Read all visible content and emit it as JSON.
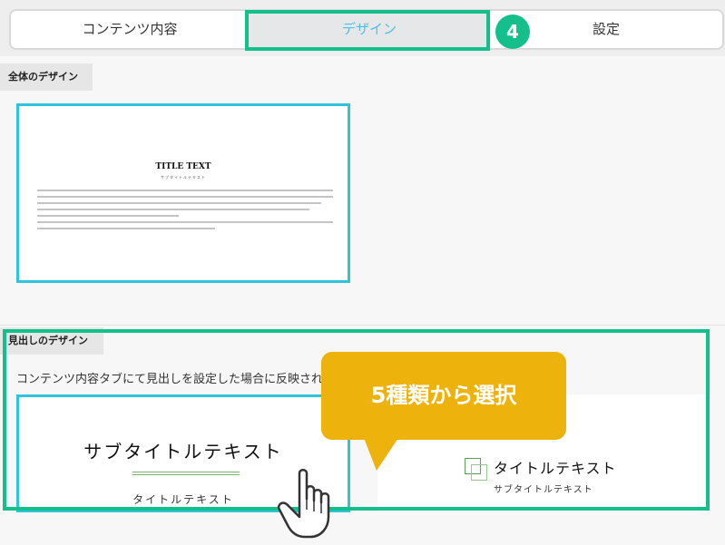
{
  "tabs": {
    "content": "コンテンツ内容",
    "design": "デザイン",
    "settings": "設定"
  },
  "step_badge": "4",
  "overall": {
    "label": "全体のデザイン",
    "preview_title": "TITLE TEXT",
    "preview_subtitle": "サブタイトルテキスト"
  },
  "heading": {
    "label": "見出しのデザイン",
    "description": "コンテンツ内容タブにて見出しを設定した場合に反映され",
    "option1": {
      "title": "サブタイトルテキスト",
      "subtitle": "タイトルテキスト"
    },
    "option2": {
      "title": "タイトルテキスト",
      "subtitle": "サブタイトルテキスト"
    }
  },
  "callout": "5種類から選択",
  "colors": {
    "highlight": "#13c08b",
    "selected_border": "#2fc4dc",
    "active_tab_text": "#4dbde5",
    "callout": "#edb20b"
  },
  "icons": [
    "hand-pointer-icon",
    "squares-icon"
  ]
}
